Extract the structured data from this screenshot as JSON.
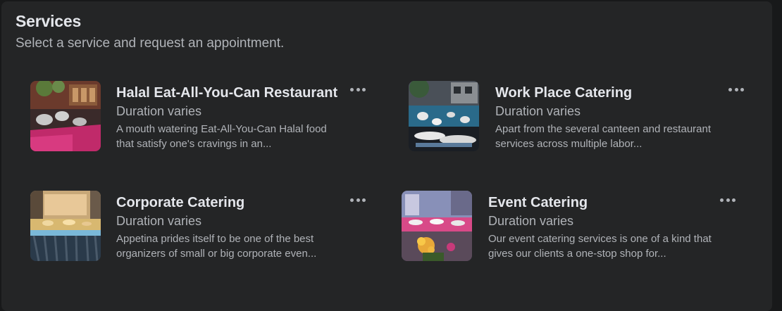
{
  "header": {
    "title": "Services",
    "subtitle": "Select a service and request an appointment."
  },
  "services": [
    {
      "name": "Halal Eat-All-You-Can Restaurant",
      "duration": "Duration varies",
      "description": "A mouth watering Eat-All-You-Can Halal food that satisfy one's cravings in an...",
      "image_icon": "buffet-photo"
    },
    {
      "name": "Work Place Catering",
      "duration": "Duration varies",
      "description": "Apart from the several canteen and restaurant services across multiple labor...",
      "image_icon": "outdoor-catering-photo"
    },
    {
      "name": "Corporate Catering",
      "duration": "Duration varies",
      "description": "Appetina prides itself to be one of the best organizers of small or big corporate even...",
      "image_icon": "corporate-buffet-photo"
    },
    {
      "name": "Event Catering",
      "duration": "Duration varies",
      "description": "Our event catering services is one of a kind that gives our clients a one-stop shop for...",
      "image_icon": "event-venue-photo"
    }
  ],
  "more_icon": "more-horizontal-icon",
  "colors": {
    "background": "#18191a",
    "panel": "#242526",
    "primary_text": "#e4e6eb",
    "secondary_text": "#b0b3b8"
  }
}
